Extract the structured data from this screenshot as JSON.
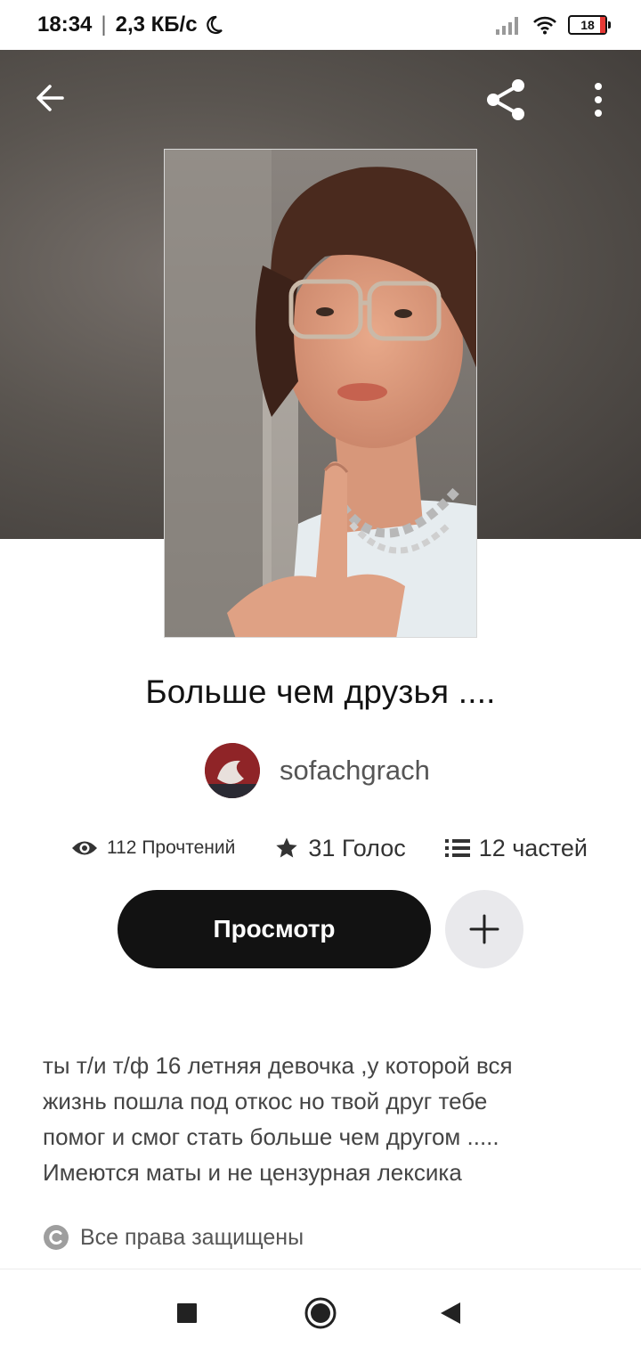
{
  "statusbar": {
    "time": "18:34",
    "speed": "2,3 КБ/с",
    "battery": "18"
  },
  "story": {
    "title": "Больше чем друзья ....",
    "author": "sofachgrach"
  },
  "stats": {
    "reads": "112 Прочтений",
    "votes": "31 Голос",
    "parts": "12 частей"
  },
  "actions": {
    "read_label": "Просмотр"
  },
  "description": {
    "lines": [
      "ты т/и т/ф 16 летняя девочка ,у которой вся",
      "жизнь пошла под откос но твой друг тебе",
      "помог и смог стать больше чем другом .....",
      "Имеются маты и не цензурная лексика"
    ]
  },
  "copyright": {
    "label": "Все права защищены"
  },
  "icons": {
    "back": "arrow-left-icon",
    "share": "share-icon",
    "more": "more-vertical-icon",
    "reads": "eye-icon",
    "votes": "star-icon",
    "parts": "list-icon",
    "add": "plus-icon",
    "copyright": "copyright-icon"
  }
}
